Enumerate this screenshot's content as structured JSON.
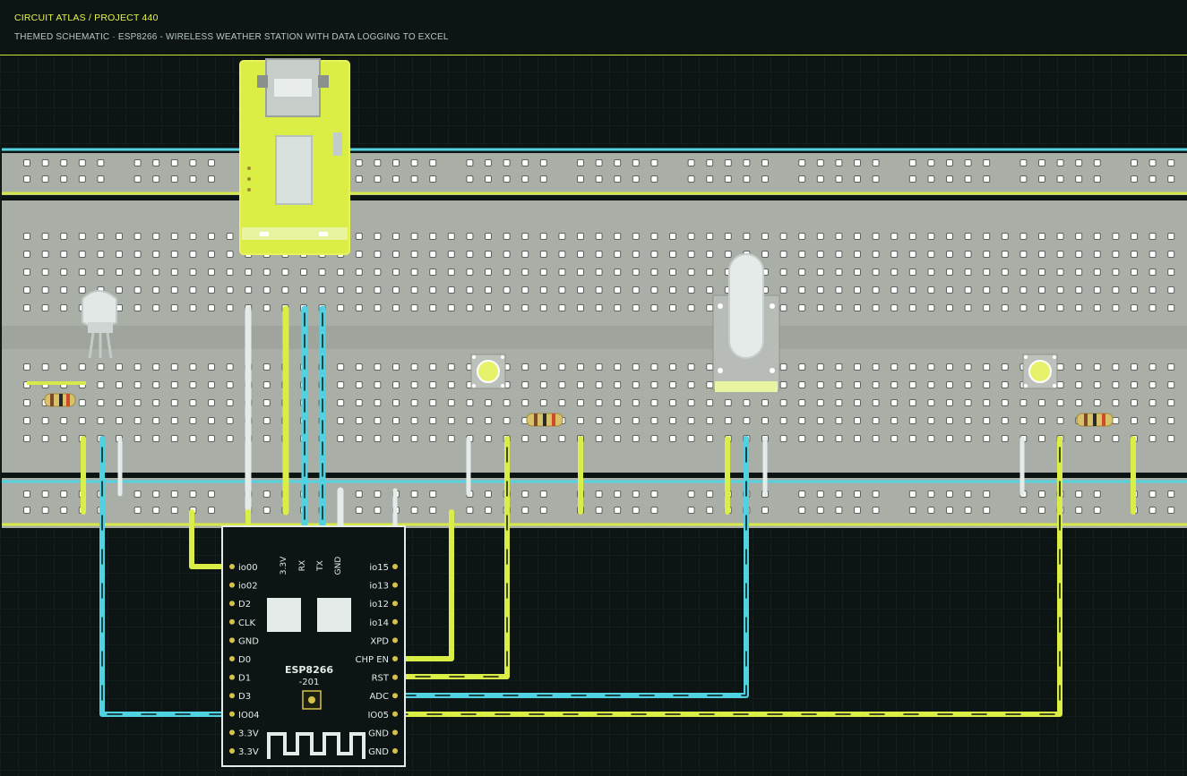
{
  "header": {
    "title": "CIRCUIT ATLAS / PROJECT 440",
    "subtitle": "THEMED SCHEMATIC · ESP8266 - WIRELESS WEATHER STATION WITH DATA LOGGING TO EXCEL"
  },
  "colors": {
    "background": "#0c1514",
    "breadboard": "#a9aea7",
    "accent_yellow": "#dbee46",
    "accent_cyan": "#4fd3e3",
    "accent_white": "#e4ebe8",
    "rail_cyan": "#56d3e0",
    "rail_yellow": "#d6e84a"
  },
  "module": {
    "name_line1": "ESP8266",
    "name_line2": "-201",
    "top_pins": [
      "3.3V",
      "RX",
      "TX",
      "GND"
    ],
    "left_pins": [
      "io00",
      "io02",
      "D2",
      "CLK",
      "GND",
      "D0",
      "D1",
      "D3",
      "IO04",
      "3.3V",
      "3.3V"
    ],
    "right_pins": [
      "io15",
      "io13",
      "io12",
      "io14",
      "XPD",
      "CHP EN",
      "RST",
      "ADC",
      "IO05",
      "GND",
      "GND"
    ]
  },
  "components": {
    "usb_adapter": "usb-serial-adapter",
    "sensor": "dht-sensor",
    "buttons": [
      "pushbutton-1",
      "pushbutton-2"
    ],
    "potentiometer": "slide-potentiometer",
    "resistors": [
      "resistor-1",
      "resistor-2",
      "resistor-3"
    ]
  }
}
